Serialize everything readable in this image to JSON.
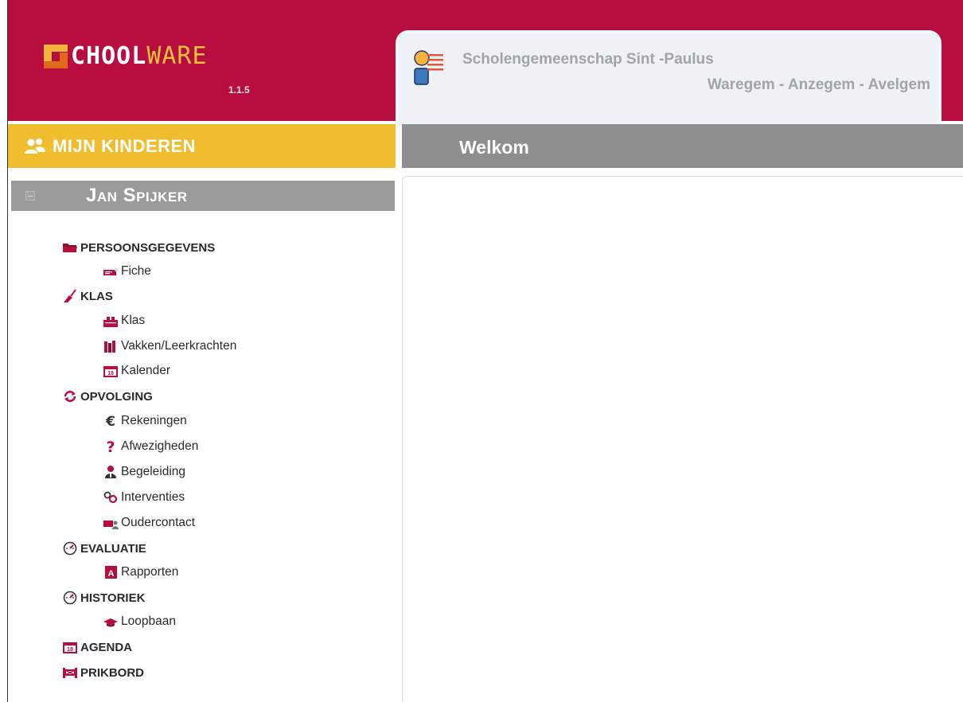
{
  "app": {
    "logo_main": "CHOOL",
    "logo_accent": "WARE",
    "version": "1.1.5"
  },
  "school": {
    "name": "Scholengemeenschap Sint -Paulus",
    "locations": "Waregem - Anzegem - Avelgem"
  },
  "sidebar": {
    "section_title": "MIJN KINDEREN",
    "child_name": "Jan Spijker",
    "groups": [
      {
        "label": "PERSOONSGEGEVENS",
        "icon": "folder-icon",
        "items": [
          {
            "label": "Fiche",
            "icon": "id-card-icon"
          }
        ]
      },
      {
        "label": "KLAS",
        "icon": "broom-icon",
        "items": [
          {
            "label": "Klas",
            "icon": "classroom-icon"
          },
          {
            "label": "Vakken/Leerkrachten",
            "icon": "books-icon"
          },
          {
            "label": "Kalender",
            "icon": "calendar-icon"
          }
        ]
      },
      {
        "label": "OPVOLGING",
        "icon": "refresh-icon",
        "items": [
          {
            "label": "Rekeningen",
            "icon": "euro-icon"
          },
          {
            "label": "Afwezigheden",
            "icon": "question-icon"
          },
          {
            "label": "Begeleiding",
            "icon": "person-icon"
          },
          {
            "label": "Interventies",
            "icon": "gender-icon"
          },
          {
            "label": "Oudercontact",
            "icon": "contact-icon"
          }
        ]
      },
      {
        "label": "EVALUATIE",
        "icon": "gauge-icon",
        "items": [
          {
            "label": "Rapporten",
            "icon": "report-icon"
          }
        ]
      },
      {
        "label": "HISTORIEK",
        "icon": "gauge-icon",
        "items": [
          {
            "label": "Loopbaan",
            "icon": "graduation-cap-icon"
          }
        ]
      },
      {
        "label": "AGENDA",
        "icon": "calendar-icon",
        "items": []
      },
      {
        "label": "PRIKBORD",
        "icon": "board-icon",
        "items": []
      }
    ]
  },
  "main": {
    "title": "Welkom"
  },
  "colors": {
    "brand_red": "#b80d3f",
    "accent_yellow": "#f0bd2e",
    "header_gray": "#8e8e8e",
    "icon_red": "#b80d3f"
  }
}
